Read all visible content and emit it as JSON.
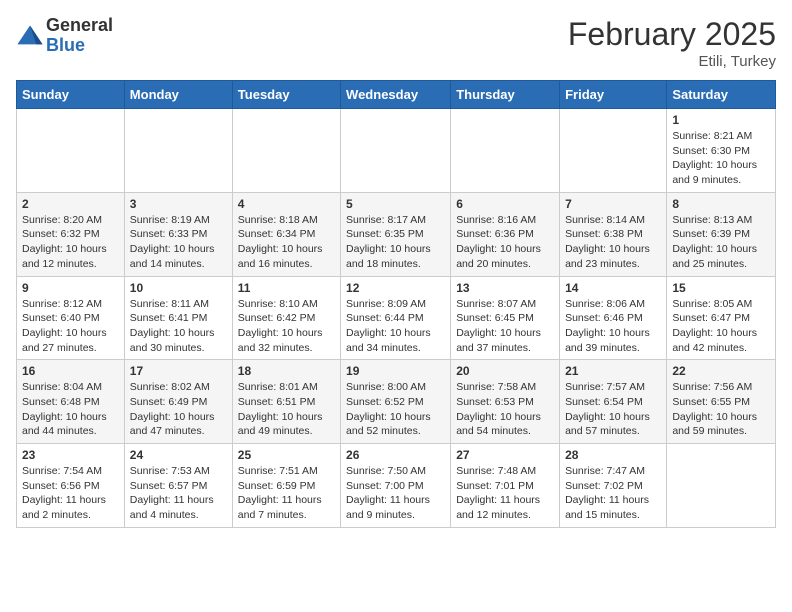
{
  "header": {
    "logo_general": "General",
    "logo_blue": "Blue",
    "month_title": "February 2025",
    "subtitle": "Etili, Turkey"
  },
  "days_of_week": [
    "Sunday",
    "Monday",
    "Tuesday",
    "Wednesday",
    "Thursday",
    "Friday",
    "Saturday"
  ],
  "weeks": [
    [
      {
        "day": "",
        "info": ""
      },
      {
        "day": "",
        "info": ""
      },
      {
        "day": "",
        "info": ""
      },
      {
        "day": "",
        "info": ""
      },
      {
        "day": "",
        "info": ""
      },
      {
        "day": "",
        "info": ""
      },
      {
        "day": "1",
        "info": "Sunrise: 8:21 AM\nSunset: 6:30 PM\nDaylight: 10 hours and 9 minutes."
      }
    ],
    [
      {
        "day": "2",
        "info": "Sunrise: 8:20 AM\nSunset: 6:32 PM\nDaylight: 10 hours and 12 minutes."
      },
      {
        "day": "3",
        "info": "Sunrise: 8:19 AM\nSunset: 6:33 PM\nDaylight: 10 hours and 14 minutes."
      },
      {
        "day": "4",
        "info": "Sunrise: 8:18 AM\nSunset: 6:34 PM\nDaylight: 10 hours and 16 minutes."
      },
      {
        "day": "5",
        "info": "Sunrise: 8:17 AM\nSunset: 6:35 PM\nDaylight: 10 hours and 18 minutes."
      },
      {
        "day": "6",
        "info": "Sunrise: 8:16 AM\nSunset: 6:36 PM\nDaylight: 10 hours and 20 minutes."
      },
      {
        "day": "7",
        "info": "Sunrise: 8:14 AM\nSunset: 6:38 PM\nDaylight: 10 hours and 23 minutes."
      },
      {
        "day": "8",
        "info": "Sunrise: 8:13 AM\nSunset: 6:39 PM\nDaylight: 10 hours and 25 minutes."
      }
    ],
    [
      {
        "day": "9",
        "info": "Sunrise: 8:12 AM\nSunset: 6:40 PM\nDaylight: 10 hours and 27 minutes."
      },
      {
        "day": "10",
        "info": "Sunrise: 8:11 AM\nSunset: 6:41 PM\nDaylight: 10 hours and 30 minutes."
      },
      {
        "day": "11",
        "info": "Sunrise: 8:10 AM\nSunset: 6:42 PM\nDaylight: 10 hours and 32 minutes."
      },
      {
        "day": "12",
        "info": "Sunrise: 8:09 AM\nSunset: 6:44 PM\nDaylight: 10 hours and 34 minutes."
      },
      {
        "day": "13",
        "info": "Sunrise: 8:07 AM\nSunset: 6:45 PM\nDaylight: 10 hours and 37 minutes."
      },
      {
        "day": "14",
        "info": "Sunrise: 8:06 AM\nSunset: 6:46 PM\nDaylight: 10 hours and 39 minutes."
      },
      {
        "day": "15",
        "info": "Sunrise: 8:05 AM\nSunset: 6:47 PM\nDaylight: 10 hours and 42 minutes."
      }
    ],
    [
      {
        "day": "16",
        "info": "Sunrise: 8:04 AM\nSunset: 6:48 PM\nDaylight: 10 hours and 44 minutes."
      },
      {
        "day": "17",
        "info": "Sunrise: 8:02 AM\nSunset: 6:49 PM\nDaylight: 10 hours and 47 minutes."
      },
      {
        "day": "18",
        "info": "Sunrise: 8:01 AM\nSunset: 6:51 PM\nDaylight: 10 hours and 49 minutes."
      },
      {
        "day": "19",
        "info": "Sunrise: 8:00 AM\nSunset: 6:52 PM\nDaylight: 10 hours and 52 minutes."
      },
      {
        "day": "20",
        "info": "Sunrise: 7:58 AM\nSunset: 6:53 PM\nDaylight: 10 hours and 54 minutes."
      },
      {
        "day": "21",
        "info": "Sunrise: 7:57 AM\nSunset: 6:54 PM\nDaylight: 10 hours and 57 minutes."
      },
      {
        "day": "22",
        "info": "Sunrise: 7:56 AM\nSunset: 6:55 PM\nDaylight: 10 hours and 59 minutes."
      }
    ],
    [
      {
        "day": "23",
        "info": "Sunrise: 7:54 AM\nSunset: 6:56 PM\nDaylight: 11 hours and 2 minutes."
      },
      {
        "day": "24",
        "info": "Sunrise: 7:53 AM\nSunset: 6:57 PM\nDaylight: 11 hours and 4 minutes."
      },
      {
        "day": "25",
        "info": "Sunrise: 7:51 AM\nSunset: 6:59 PM\nDaylight: 11 hours and 7 minutes."
      },
      {
        "day": "26",
        "info": "Sunrise: 7:50 AM\nSunset: 7:00 PM\nDaylight: 11 hours and 9 minutes."
      },
      {
        "day": "27",
        "info": "Sunrise: 7:48 AM\nSunset: 7:01 PM\nDaylight: 11 hours and 12 minutes."
      },
      {
        "day": "28",
        "info": "Sunrise: 7:47 AM\nSunset: 7:02 PM\nDaylight: 11 hours and 15 minutes."
      },
      {
        "day": "",
        "info": ""
      }
    ]
  ]
}
